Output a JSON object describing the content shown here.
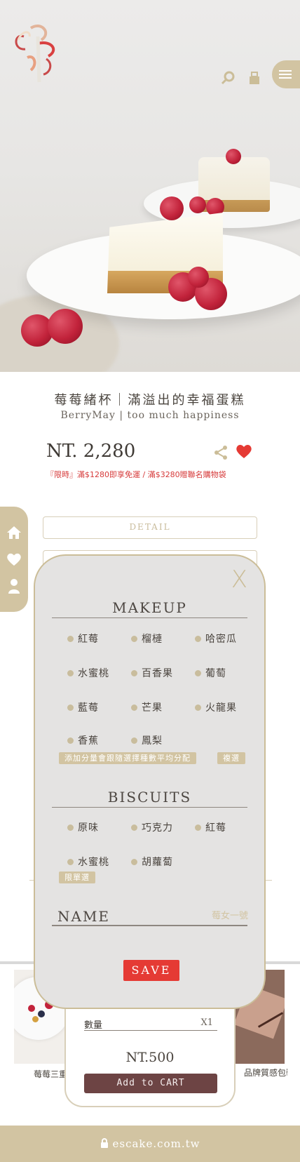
{
  "header": {
    "logo_icon": "escake-logo",
    "search_icon": "search-icon",
    "cart_icon": "cart-icon",
    "menu_icon": "hamburger-menu-icon"
  },
  "product": {
    "title_zh": "莓莓緒杯｜滿溢出的幸福蛋糕",
    "title_en": "BerryMay | too much happiness",
    "price": "NT. 2,280",
    "promo": "『限時』滿$1280即享免運 / 滿$3280贈聯名購物袋"
  },
  "side_nav": [
    "home-icon",
    "heart-icon",
    "user-icon"
  ],
  "detail_button": "DETAIL",
  "modal": {
    "close_label": "X",
    "makeup_title": "MAKEUP",
    "makeup_options": [
      "紅莓",
      "榴槤",
      "哈密瓜",
      "水蜜桃",
      "百香果",
      "葡萄",
      "藍莓",
      "芒果",
      "火龍果",
      "香蕉",
      "鳳梨"
    ],
    "makeup_note": "添加分量會跟隨選擇種數平均分配",
    "makeup_mode": "複選",
    "biscuits_title": "BISCUITS",
    "biscuits_options": [
      "原味",
      "巧克力",
      "紅莓",
      "水蜜桃",
      "胡蘿蔔"
    ],
    "biscuits_mode": "限單選",
    "name_label": "NAME",
    "name_placeholder": "莓女一號",
    "save_label": "SAVE"
  },
  "related": {
    "left_label": "莓莓三重奏",
    "right_label": "品牌質感包裝"
  },
  "cart": {
    "qty_label": "數量",
    "qty_value": "X1",
    "price": "NT.500",
    "add_label": "Add to CART"
  },
  "footer": {
    "lock_icon": "lock-icon",
    "url": "escake.com.tw"
  },
  "colors": {
    "accent_tan": "#d2c4a2",
    "save_red": "#e53a34",
    "cart_brown": "#6d4444",
    "promo_red": "#d63a3a"
  }
}
